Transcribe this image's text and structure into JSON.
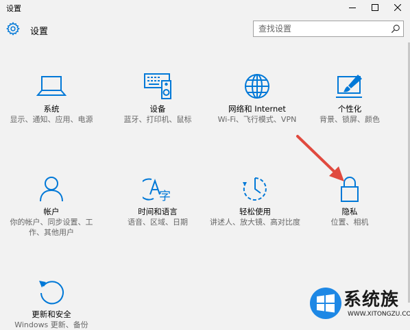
{
  "window": {
    "title": "设置",
    "minimize": "—",
    "maximize": "☐",
    "close": "✕"
  },
  "header": {
    "title": "设置",
    "icon": "gear-icon"
  },
  "search": {
    "placeholder": "查找设置",
    "icon": "search-icon"
  },
  "accent_color": "#0078d7",
  "arrow_color": "#e04a3f",
  "tiles": [
    {
      "name": "系统",
      "desc": "显示、通知、应用、电源",
      "icon": "laptop-icon"
    },
    {
      "name": "设备",
      "desc": "蓝牙、打印机、鼠标",
      "icon": "devices-icon"
    },
    {
      "name": "网络和 Internet",
      "desc": "Wi-Fi、飞行模式、VPN",
      "icon": "globe-icon"
    },
    {
      "name": "个性化",
      "desc": "背景、锁屏、颜色",
      "icon": "paintbrush-icon"
    },
    {
      "name": "帐户",
      "desc": "你的帐户、同步设置、工作、其他用户",
      "icon": "person-icon"
    },
    {
      "name": "时间和语言",
      "desc": "语音、区域、日期",
      "icon": "language-icon"
    },
    {
      "name": "轻松使用",
      "desc": "讲述人、放大镜、高对比度",
      "icon": "ease-of-access-icon"
    },
    {
      "name": "隐私",
      "desc": "位置、相机",
      "icon": "lock-icon"
    },
    {
      "name": "更新和安全",
      "desc": "Windows 更新、备份",
      "icon": "update-icon"
    }
  ],
  "watermark": {
    "text": "系统族",
    "url": "WWW.XITONGZU.COM"
  }
}
